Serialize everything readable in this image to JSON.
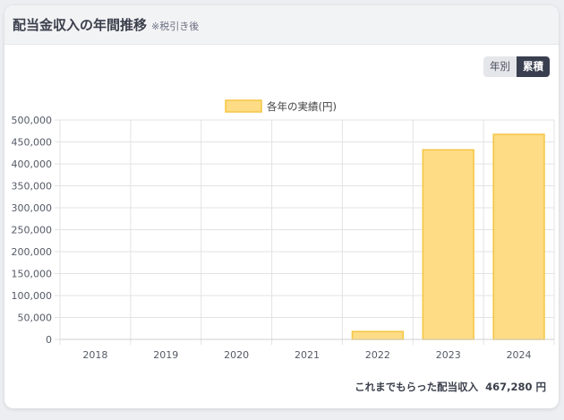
{
  "header": {
    "title": "配当金収入の年間推移",
    "note": "※税引き後"
  },
  "toggle": {
    "yearly_label": "年別",
    "cumulative_label": "累積",
    "active": "cumulative"
  },
  "footer": {
    "total_label": "これまでもらった配当収入",
    "total_value": "467,280 円"
  },
  "colors": {
    "bar_fill": "#fddc85",
    "bar_stroke": "#f5c542",
    "grid": "#e3e3e3",
    "active_toggle": "#3a3f4f"
  },
  "chart_data": {
    "type": "bar",
    "title": "",
    "xlabel": "",
    "ylabel": "",
    "categories": [
      "2018",
      "2019",
      "2020",
      "2021",
      "2022",
      "2023",
      "2024"
    ],
    "series": [
      {
        "name": "各年の実績(円)",
        "values": [
          0,
          0,
          0,
          0,
          18000,
          432000,
          467280
        ]
      }
    ],
    "ylim": [
      0,
      500000
    ],
    "yticks": [
      0,
      50000,
      100000,
      150000,
      200000,
      250000,
      300000,
      350000,
      400000,
      450000,
      500000
    ],
    "ytick_labels": [
      "0",
      "50,000",
      "100,000",
      "150,000",
      "200,000",
      "250,000",
      "300,000",
      "350,000",
      "400,000",
      "450,000",
      "500,000"
    ],
    "grid": true,
    "legend": "top-center"
  }
}
